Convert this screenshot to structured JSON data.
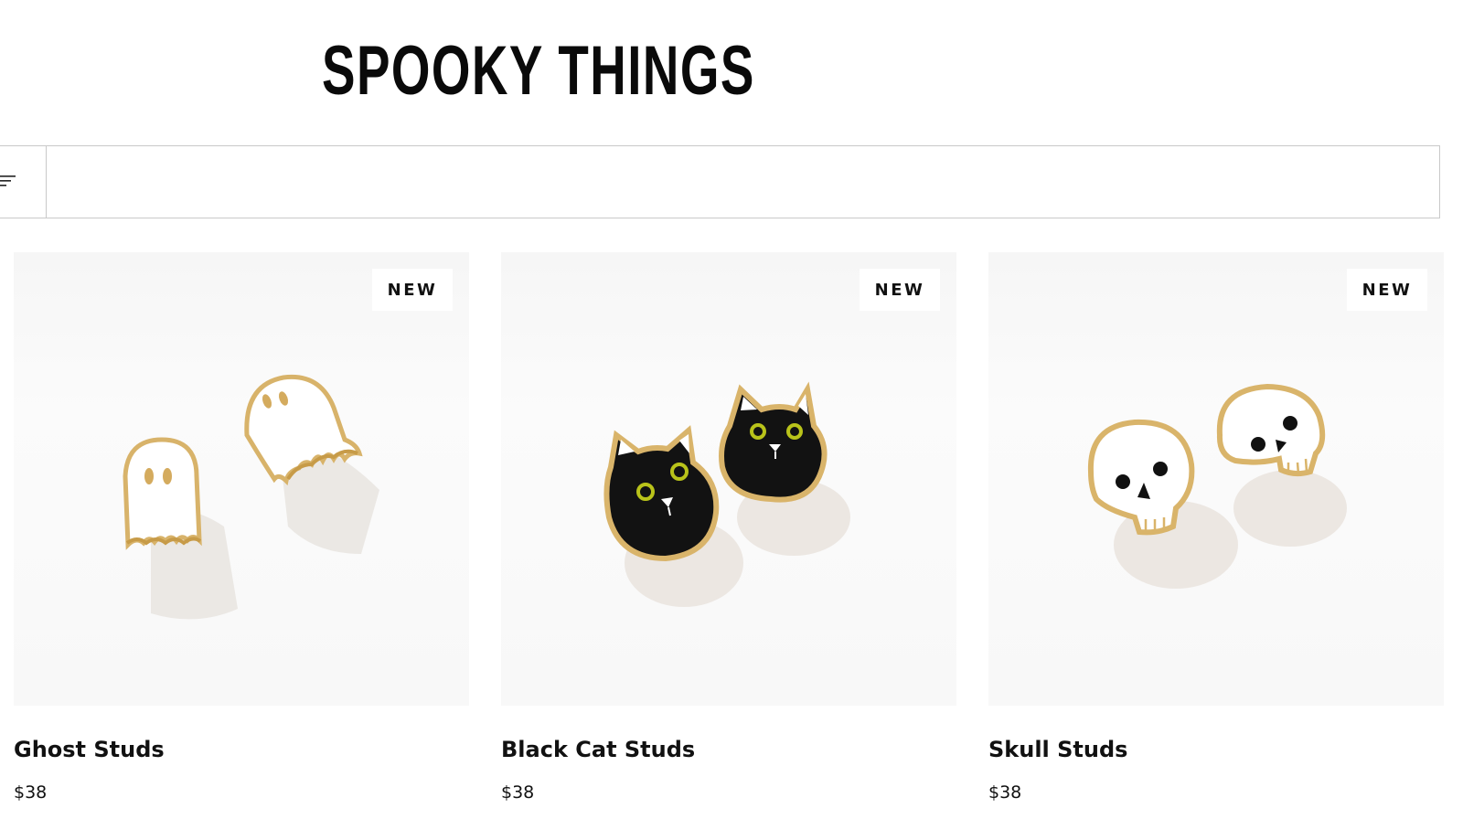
{
  "collection": {
    "title": "SPOOKY THINGS"
  },
  "filter": {
    "icon": "filter-lines-icon"
  },
  "products": [
    {
      "name": "Ghost Studs",
      "price": "$38",
      "badge": "NEW",
      "image": "ghost-studs-image"
    },
    {
      "name": "Black Cat Studs",
      "price": "$38",
      "badge": "NEW",
      "image": "black-cat-studs-image"
    },
    {
      "name": "Skull Studs",
      "price": "$38",
      "badge": "NEW",
      "image": "skull-studs-image"
    }
  ],
  "colors": {
    "gold": "#d9b46a",
    "enamel_black": "#121212",
    "enamel_white": "#ffffff",
    "cat_eye": "#b9c31a"
  }
}
